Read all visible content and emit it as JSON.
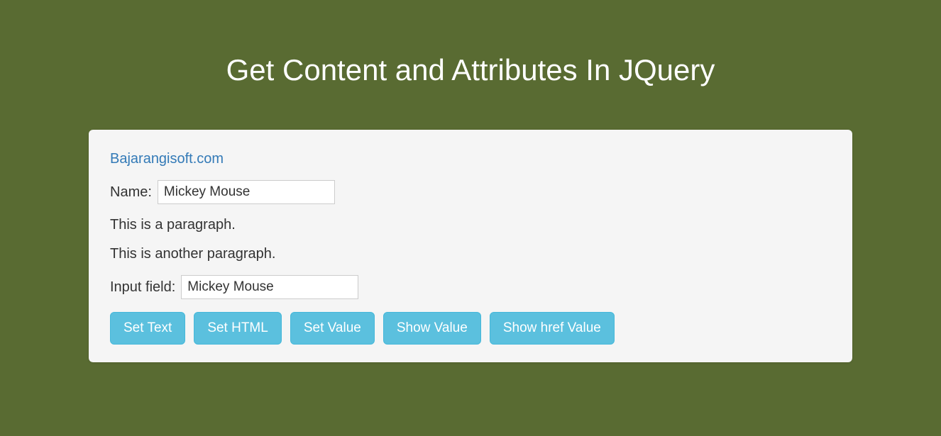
{
  "header": {
    "title": "Get Content and Attributes In JQuery"
  },
  "card": {
    "link_text": "Bajarangisoft.com",
    "name_label": "Name:",
    "name_value": "Mickey Mouse",
    "paragraph1": "This is a paragraph.",
    "paragraph2": "This is another paragraph.",
    "input_label": "Input field:",
    "input_value": "Mickey Mouse"
  },
  "buttons": {
    "set_text": "Set Text",
    "set_html": "Set HTML",
    "set_value": "Set Value",
    "show_value": "Show Value",
    "show_href": "Show href Value"
  }
}
